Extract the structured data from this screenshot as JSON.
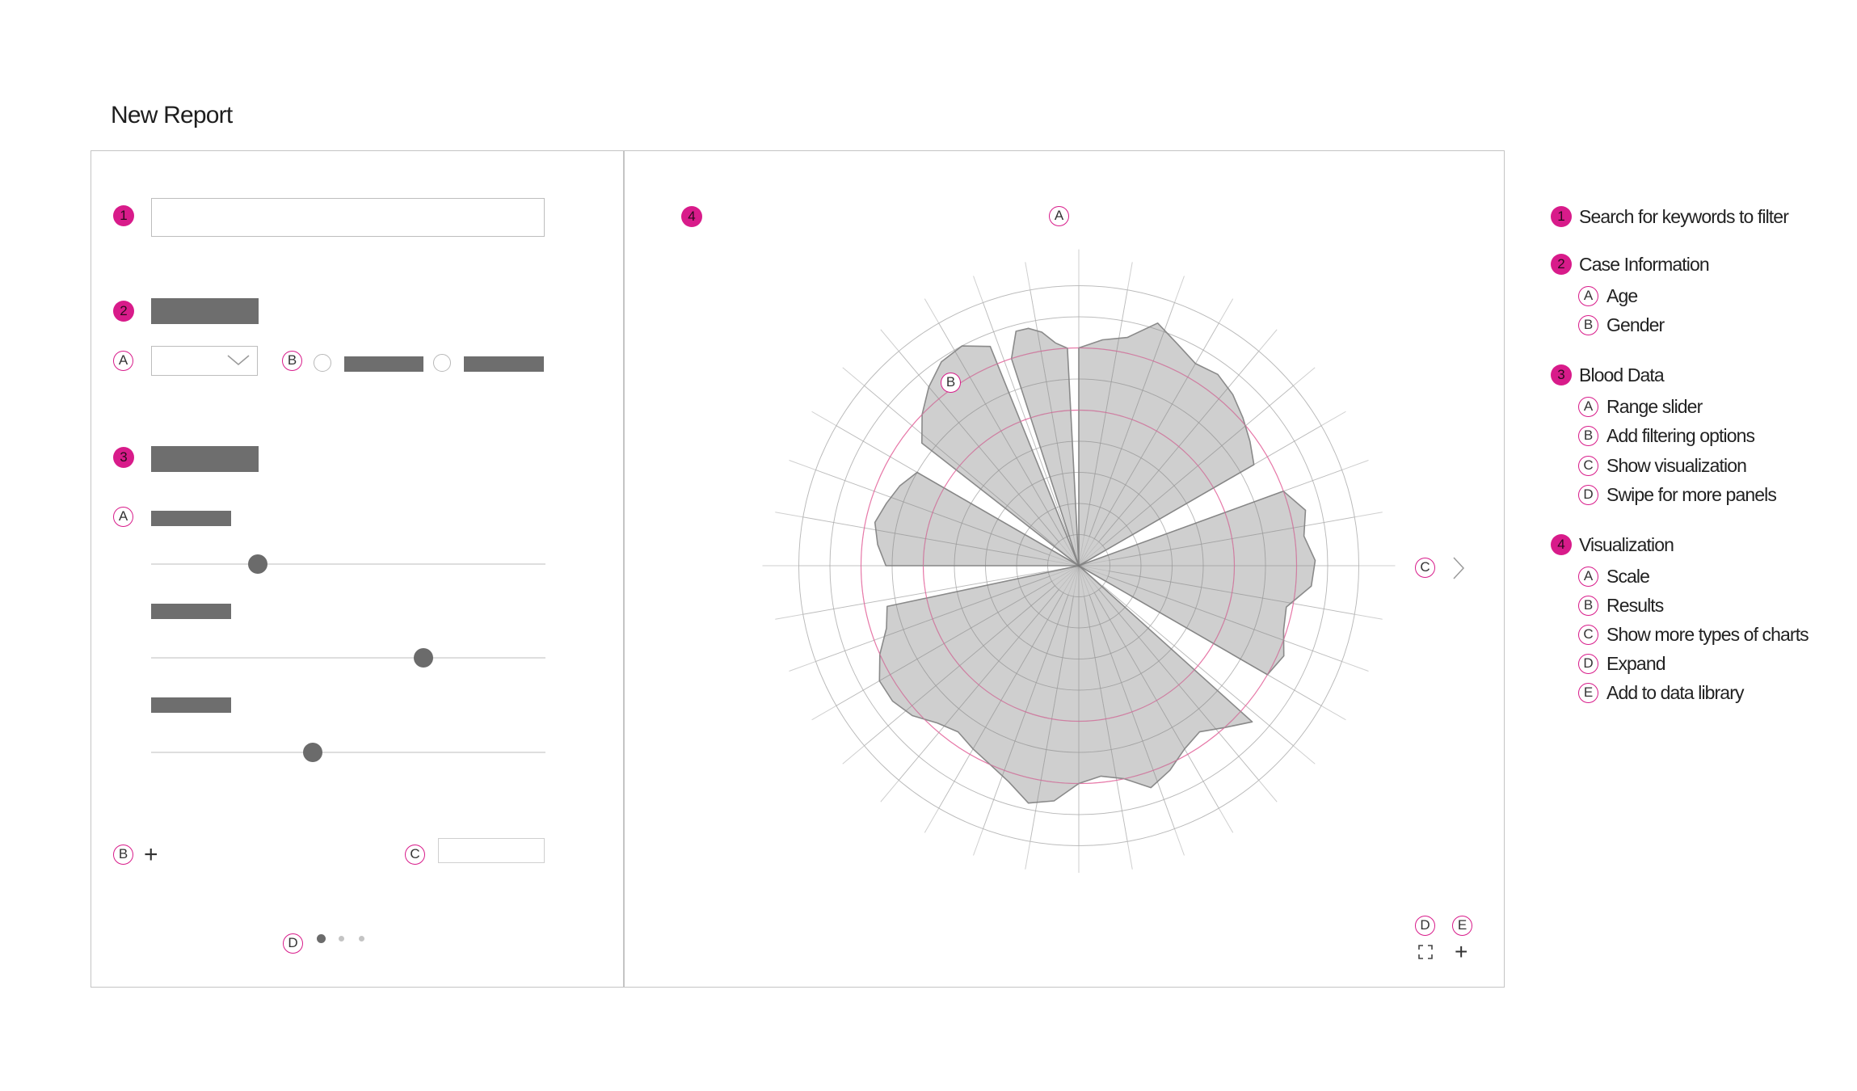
{
  "page": {
    "title": "New Report"
  },
  "left_panel": {
    "badges": {
      "search": "1",
      "case_info": "2",
      "blood_data": "3"
    },
    "sub": {
      "a": "A",
      "b": "B",
      "a2": "A",
      "b2": "B",
      "c": "C",
      "d": "D"
    },
    "sliders": [
      0.27,
      0.69,
      0.41
    ],
    "pagination": {
      "total": 3,
      "active": 1
    }
  },
  "viz_panel": {
    "badge": "4",
    "sub": {
      "a": "A",
      "b": "B",
      "c": "C",
      "d": "D",
      "e": "E"
    },
    "icons": [
      "chevron-right-icon",
      "expand-icon",
      "plus-icon"
    ]
  },
  "chart_data": {
    "type": "radar",
    "rings": 9,
    "highlight_rings": [
      5,
      7
    ],
    "spokes": 36,
    "max": 10,
    "petals": [
      {
        "start": -18,
        "end": -3,
        "values": [
          7.0,
          7.8,
          7.8,
          7.6,
          7.2,
          7.0
        ]
      },
      {
        "start": 0,
        "end": 60,
        "values": [
          7.0,
          7.3,
          7.5,
          8.2,
          7.8,
          7.5,
          7.6,
          7.4,
          7.1,
          6.8,
          6.5
        ]
      },
      {
        "start": 70,
        "end": 120,
        "values": [
          7.0,
          7.5,
          7.3,
          7.6,
          7.5,
          6.8,
          6.9,
          7.2,
          7.0
        ]
      },
      {
        "start": 132,
        "end": 258,
        "values": [
          7.5,
          7.0,
          6.6,
          6.8,
          7.2,
          7.5,
          7.0,
          6.8,
          7.0,
          7.6,
          7.8,
          7.3,
          7.0,
          6.8,
          6.6,
          6.8,
          7.2,
          7.4,
          7.4,
          7.0,
          6.5,
          6.3
        ]
      },
      {
        "start": 270,
        "end": 300,
        "values": [
          6.2,
          6.5,
          6.7,
          6.5,
          6.3,
          6.0
        ]
      },
      {
        "start": 308,
        "end": 338,
        "values": [
          6.4,
          7.0,
          7.5,
          7.9,
          8.0,
          7.6
        ]
      }
    ]
  },
  "legend": {
    "badges": [
      "1",
      "2",
      "3",
      "4"
    ],
    "items": [
      {
        "label": "Search for keywords to filter"
      },
      {
        "label": "Case Information"
      },
      {
        "letter": "A",
        "label": "Age"
      },
      {
        "letter": "B",
        "label": "Gender"
      },
      {
        "label": "Blood Data"
      },
      {
        "letter": "A",
        "label": "Range slider"
      },
      {
        "letter": "B",
        "label": "Add filtering options"
      },
      {
        "letter": "C",
        "label": "Show visualization"
      },
      {
        "letter": "D",
        "label": "Swipe for more panels"
      },
      {
        "label": "Visualization"
      },
      {
        "letter": "A",
        "label": "Scale"
      },
      {
        "letter": "B",
        "label": "Results"
      },
      {
        "letter": "C",
        "label": "Show more types of charts"
      },
      {
        "letter": "D",
        "label": "Expand"
      },
      {
        "letter": "E",
        "label": "Add to data library"
      }
    ]
  }
}
